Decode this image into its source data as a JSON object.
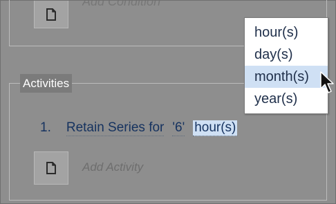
{
  "conditions": {
    "add_label": "Add Condition",
    "add_icon": "document-icon"
  },
  "activities": {
    "legend": "Activities",
    "rows": [
      {
        "number": "1.",
        "action": "Retain Series for",
        "value": "'6'",
        "unit": "hour(s)"
      }
    ],
    "add_label": "Add Activity",
    "add_icon": "document-icon"
  },
  "unit_dropdown": {
    "options": [
      "hour(s)",
      "day(s)",
      "month(s)",
      "year(s)"
    ],
    "highlighted": "month(s)"
  },
  "colors": {
    "background": "#8e8e8e",
    "link_text": "#15325f",
    "highlight": "#cfe0f4",
    "legend_bg": "#7b7b7b"
  }
}
